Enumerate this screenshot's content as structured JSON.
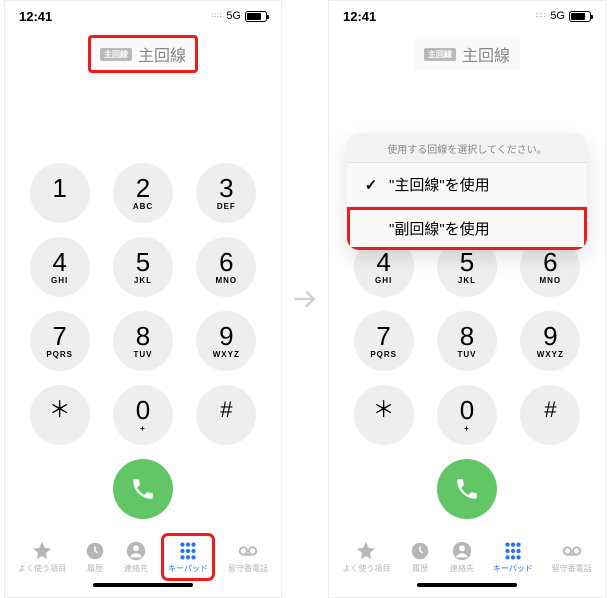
{
  "status": {
    "time": "12:41",
    "network_label": "5G"
  },
  "line_picker": {
    "badge": "主回線",
    "label": "主回線"
  },
  "line_sheet": {
    "header": "使用する回線を選択してください。",
    "options": [
      {
        "check": "✓",
        "label": "\"主回線\"を使用"
      },
      {
        "check": "",
        "label": "\"副回線\"を使用"
      }
    ]
  },
  "keypad": [
    {
      "digit": "1",
      "letters": ""
    },
    {
      "digit": "2",
      "letters": "ABC"
    },
    {
      "digit": "3",
      "letters": "DEF"
    },
    {
      "digit": "4",
      "letters": "GHI"
    },
    {
      "digit": "5",
      "letters": "JKL"
    },
    {
      "digit": "6",
      "letters": "MNO"
    },
    {
      "digit": "7",
      "letters": "PQRS"
    },
    {
      "digit": "8",
      "letters": "TUV"
    },
    {
      "digit": "9",
      "letters": "WXYZ"
    },
    {
      "digit": "＊",
      "letters": ""
    },
    {
      "digit": "0",
      "letters": "+"
    },
    {
      "digit": "#",
      "letters": ""
    }
  ],
  "tabs": [
    {
      "name": "favorites",
      "label": "よく使う項目"
    },
    {
      "name": "recents",
      "label": "履歴"
    },
    {
      "name": "contacts",
      "label": "連絡先"
    },
    {
      "name": "keypad",
      "label": "キーパッド"
    },
    {
      "name": "voicemail",
      "label": "留守番電話"
    }
  ]
}
